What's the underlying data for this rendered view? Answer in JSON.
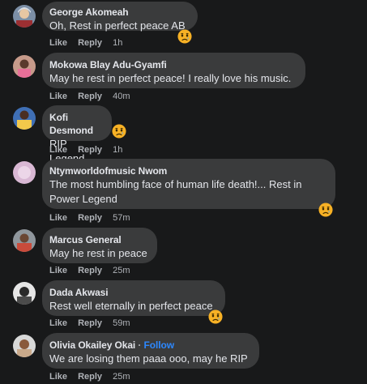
{
  "actions": {
    "like": "Like",
    "reply": "Reply"
  },
  "follow_label": "Follow",
  "comments": [
    {
      "author": "George Akomeah",
      "text": "Oh, Rest in perfect peace AB",
      "time": "1h",
      "reaction": "sad"
    },
    {
      "author": "Mokowa Blay Adu-Gyamfi",
      "text": "May he rest in perfect peace! I really love his music.",
      "time": "40m"
    },
    {
      "author": "Kofi Desmond",
      "text": "RIP Legend",
      "time": "1h",
      "reaction": "sad"
    },
    {
      "author": "Ntymworldofmusic Nwom",
      "text_line1": "The most humbling face of human life death!... Rest in",
      "text_line2": "Power Legend",
      "time": "57m",
      "reaction": "sad"
    },
    {
      "author": "Marcus General",
      "text": "May he rest in peace",
      "time": "25m"
    },
    {
      "author": "Dada Akwasi",
      "text": "Rest well eternally in perfect peace",
      "time": "59m",
      "reaction": "sad"
    },
    {
      "author": "Olivia Okailey Okai",
      "text": "We are losing them paaa ooo, may he RIP",
      "time": "25m",
      "show_follow": true
    }
  ],
  "colors": {
    "background": "#18191a",
    "bubble": "#3a3b3c",
    "primary_text": "#e4e6eb",
    "secondary_text": "#b0b3b8",
    "link": "#2d88ff",
    "sad_face": "#f7b125"
  }
}
